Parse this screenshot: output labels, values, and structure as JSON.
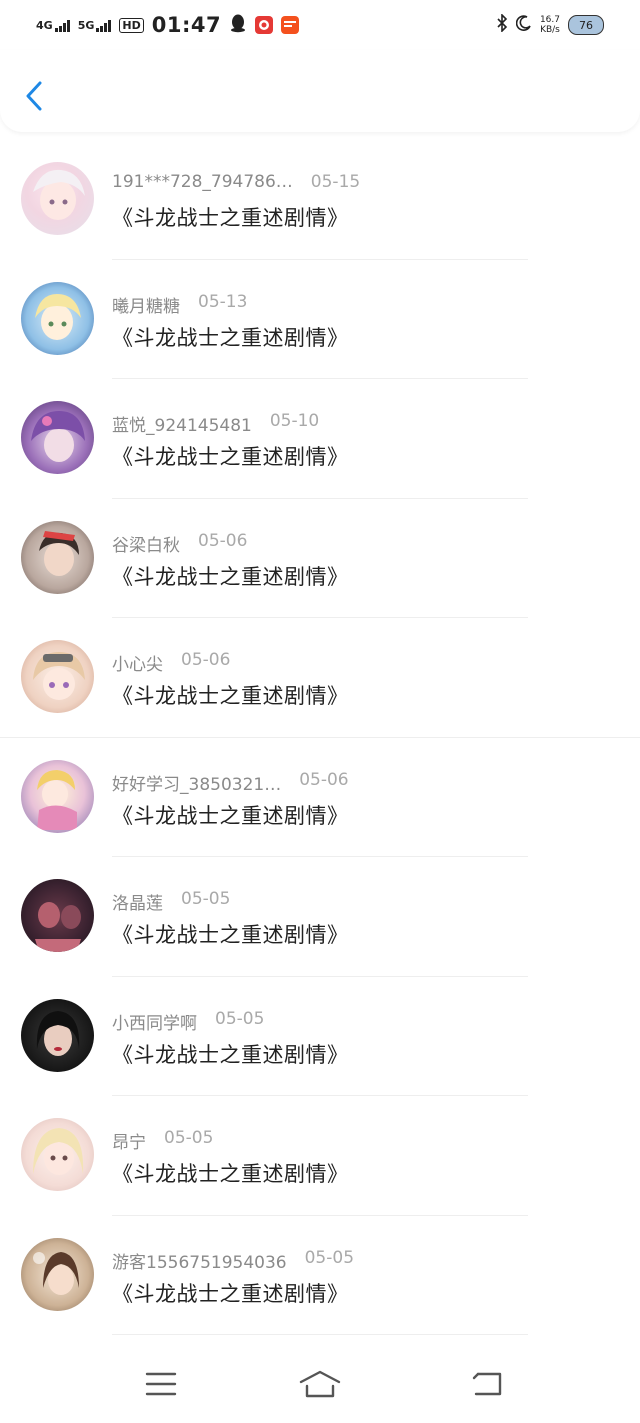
{
  "status_bar": {
    "net1": "4G",
    "net2": "5G",
    "hd": "HD",
    "time": "01:47",
    "speed_value": "16.7",
    "speed_unit": "KB/s",
    "battery": "76"
  },
  "header": {
    "back_icon": "chevron-left-icon",
    "accent_color": "#1e88e5"
  },
  "items": [
    {
      "name": "191***728_794786…",
      "date": "05-15",
      "title": "《斗龙战士之重述剧情》"
    },
    {
      "name": "曦月糖糖",
      "date": "05-13",
      "title": "《斗龙战士之重述剧情》"
    },
    {
      "name": "蓝悦_924145481",
      "date": "05-10",
      "title": "《斗龙战士之重述剧情》"
    },
    {
      "name": "谷梁白秋",
      "date": "05-06",
      "title": "《斗龙战士之重述剧情》"
    },
    {
      "name": "小心尖",
      "date": "05-06",
      "title": "《斗龙战士之重述剧情》"
    },
    {
      "name": "好好学习_3850321…",
      "date": "05-06",
      "title": "《斗龙战士之重述剧情》"
    },
    {
      "name": "洛晶莲",
      "date": "05-05",
      "title": "《斗龙战士之重述剧情》"
    },
    {
      "name": "小西同学啊",
      "date": "05-05",
      "title": "《斗龙战士之重述剧情》"
    },
    {
      "name": "昂宁",
      "date": "05-05",
      "title": "《斗龙战士之重述剧情》"
    },
    {
      "name": "游客1556751954036",
      "date": "05-05",
      "title": "《斗龙战士之重述剧情》"
    }
  ],
  "navbar": {
    "menu_icon": "menu-icon",
    "home_icon": "home-icon",
    "back_icon": "back-icon"
  }
}
